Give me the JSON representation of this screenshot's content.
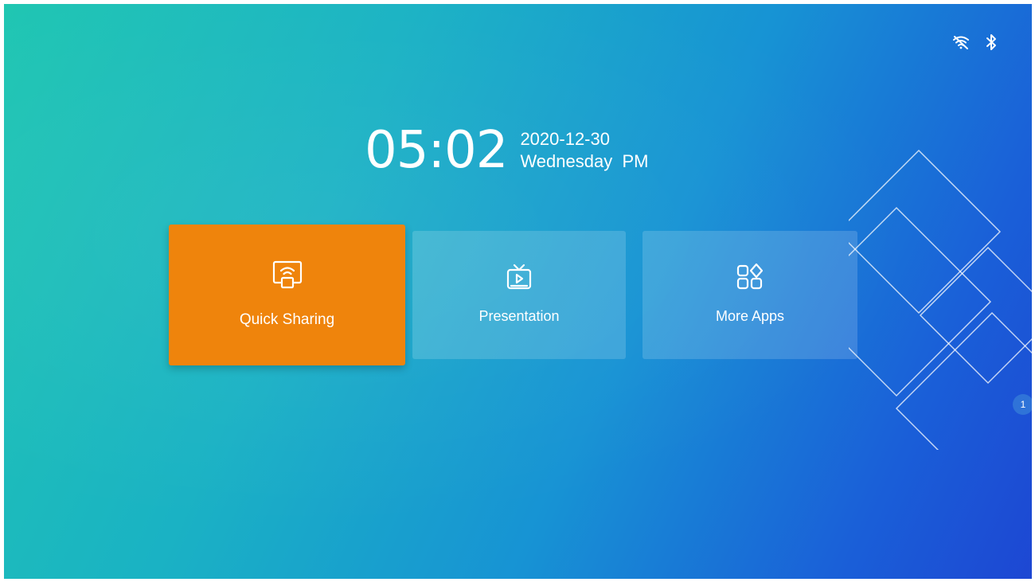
{
  "status_bar": {
    "icons": [
      "wifi-off-icon",
      "bluetooth-icon"
    ]
  },
  "clock": {
    "time": "05:02",
    "date": "2020-12-30",
    "day_period": "Wednesday  PM"
  },
  "tiles": [
    {
      "label": "Quick Sharing",
      "icon": "screen-share-icon",
      "color": "#ef840c"
    },
    {
      "label": "Presentation",
      "icon": "tv-play-icon"
    },
    {
      "label": "More Apps",
      "icon": "apps-grid-icon"
    }
  ],
  "pager": {
    "page": "1"
  },
  "colors": {
    "accent": "#ef840c",
    "gradient_start": "#1fc6b2",
    "gradient_end": "#1d47d3"
  }
}
